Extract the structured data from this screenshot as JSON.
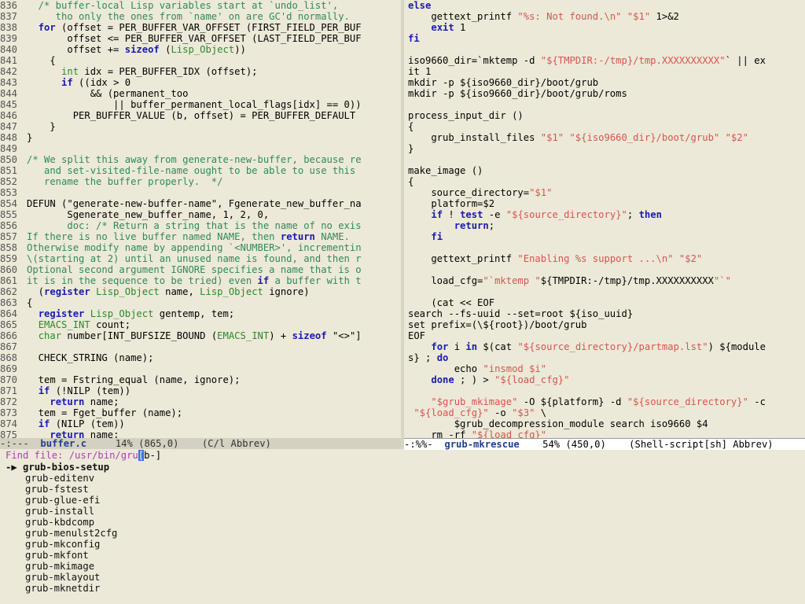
{
  "left_buffer": {
    "lines": [
      {
        "n": "836",
        "t": "  /* buffer-local Lisp variables start at `undo_list',"
      },
      {
        "n": "837",
        "t": "     tho only the ones from `name' on are GC'd normally."
      },
      {
        "n": "838",
        "t": "  for (offset = PER_BUFFER_VAR_OFFSET (FIRST_FIELD_PER_BUF"
      },
      {
        "n": "839",
        "t": "       offset <= PER_BUFFER_VAR_OFFSET (LAST_FIELD_PER_BUF"
      },
      {
        "n": "840",
        "t": "       offset += sizeof (Lisp_Object))"
      },
      {
        "n": "841",
        "t": "    {"
      },
      {
        "n": "842",
        "t": "      int idx = PER_BUFFER_IDX (offset);"
      },
      {
        "n": "843",
        "t": "      if ((idx > 0"
      },
      {
        "n": "844",
        "t": "           && (permanent_too"
      },
      {
        "n": "845",
        "t": "               || buffer_permanent_local_flags[idx] == 0))"
      },
      {
        "n": "846",
        "t": "        PER_BUFFER_VALUE (b, offset) = PER_BUFFER_DEFAULT"
      },
      {
        "n": "847",
        "t": "    }"
      },
      {
        "n": "848",
        "t": "}"
      },
      {
        "n": "849",
        "t": ""
      },
      {
        "n": "850",
        "t": "/* We split this away from generate-new-buffer, because re"
      },
      {
        "n": "851",
        "t": "   and set-visited-file-name ought to be able to use this"
      },
      {
        "n": "852",
        "t": "   rename the buffer properly.  */"
      },
      {
        "n": "853",
        "t": ""
      },
      {
        "n": "854",
        "t": "DEFUN (\"generate-new-buffer-name\", Fgenerate_new_buffer_na"
      },
      {
        "n": "855",
        "t": "       Sgenerate_new_buffer_name, 1, 2, 0,"
      },
      {
        "n": "856",
        "t": "       doc: /* Return a string that is the name of no exis"
      },
      {
        "n": "857",
        "t": "If there is no live buffer named NAME, then return NAME."
      },
      {
        "n": "858",
        "t": "Otherwise modify name by appending `<NUMBER>', incrementin"
      },
      {
        "n": "859",
        "t": "\\(starting at 2) until an unused name is found, and then r"
      },
      {
        "n": "860",
        "t": "Optional second argument IGNORE specifies a name that is o"
      },
      {
        "n": "861",
        "t": "it is in the sequence to be tried) even if a buffer with t"
      },
      {
        "n": "862",
        "t": "  (register Lisp_Object name, Lisp_Object ignore)"
      },
      {
        "n": "863",
        "t": "{"
      },
      {
        "n": "864",
        "t": "  register Lisp_Object gentemp, tem;"
      },
      {
        "n": "865",
        "t": "  EMACS_INT count;"
      },
      {
        "n": "866",
        "t": "  char number[INT_BUFSIZE_BOUND (EMACS_INT) + sizeof \"<>\"]"
      },
      {
        "n": "867",
        "t": ""
      },
      {
        "n": "868",
        "t": "  CHECK_STRING (name);"
      },
      {
        "n": "869",
        "t": ""
      },
      {
        "n": "870",
        "t": "  tem = Fstring_equal (name, ignore);"
      },
      {
        "n": "871",
        "t": "  if (!NILP (tem))"
      },
      {
        "n": "872",
        "t": "    return name;"
      },
      {
        "n": "873",
        "t": "  tem = Fget_buffer (name);"
      },
      {
        "n": "874",
        "t": "  if (NILP (tem))"
      },
      {
        "n": "875",
        "t": "    return name;"
      }
    ],
    "truncation_glyph": "▸"
  },
  "right_buffer": {
    "lines": [
      "else",
      "    gettext_printf \"%s: Not found.\\n\" \"$1\" 1>&2",
      "    exit 1",
      "fi",
      "",
      "iso9660_dir=`mktemp -d \"${TMPDIR:-/tmp}/tmp.XXXXXXXXXX\"` || ex",
      "it 1",
      "mkdir -p ${iso9660_dir}/boot/grub",
      "mkdir -p ${iso9660_dir}/boot/grub/roms",
      "",
      "process_input_dir ()",
      "{",
      "    grub_install_files \"$1\" \"${iso9660_dir}/boot/grub\" \"$2\"",
      "}",
      "",
      "make_image ()",
      "{",
      "    source_directory=\"$1\"",
      "    platform=$2",
      "    if ! test -e \"${source_directory}\"; then",
      "        return;",
      "    fi",
      "",
      "    gettext_printf \"Enabling %s support ...\\n\" \"$2\"",
      "",
      "    load_cfg=\"`mktemp \"${TMPDIR:-/tmp}/tmp.XXXXXXXXXX\"`\"",
      "",
      "    (cat << EOF",
      "search --fs-uuid --set=root ${iso_uuid}",
      "set prefix=(\\${root})/boot/grub",
      "EOF",
      "    for i in $(cat \"${source_directory}/partmap.lst\") ${module",
      "s} ; do",
      "        echo \"insmod $i\"",
      "    done ; ) > \"${load_cfg}\"",
      "",
      "    \"$grub_mkimage\" -O ${platform} -d \"${source_directory}\" -c",
      " \"${load_cfg}\" -o \"$3\" \\",
      "        $grub_decompression_module search iso9660 $4",
      "    rm -rf \"${load_cfg}\""
    ]
  },
  "modeline_left": {
    "status": "-:---  ",
    "buffer": "buffer.c",
    "rest": "     14% (865,0)    (C/l Abbrev)"
  },
  "modeline_right": {
    "status": "-:%%-  ",
    "buffer": "grub-mkrescue",
    "rest": "    54% (450,0)    (Shell-script[sh] Abbrev)"
  },
  "minibuffer": {
    "prompt": "Find file: ",
    "typed_before": "/usr/bin/gru",
    "cursor_char": "[",
    "typed_after": "b-]",
    "arrow": "-▶ ",
    "selected": "grub-bios-setup",
    "completions": [
      "grub-editenv",
      "grub-fstest",
      "grub-glue-efi",
      "grub-install",
      "grub-kbdcomp",
      "grub-menulst2cfg",
      "grub-mkconfig",
      "grub-mkfont",
      "grub-mkimage",
      "grub-mklayout",
      "grub-mknetdir"
    ]
  },
  "colors": {
    "background": "#ece9d8",
    "keyword": "#1a1ab0",
    "comment": "#2e8b57",
    "string": "#d9534f",
    "prompt": "#b03cb0"
  }
}
